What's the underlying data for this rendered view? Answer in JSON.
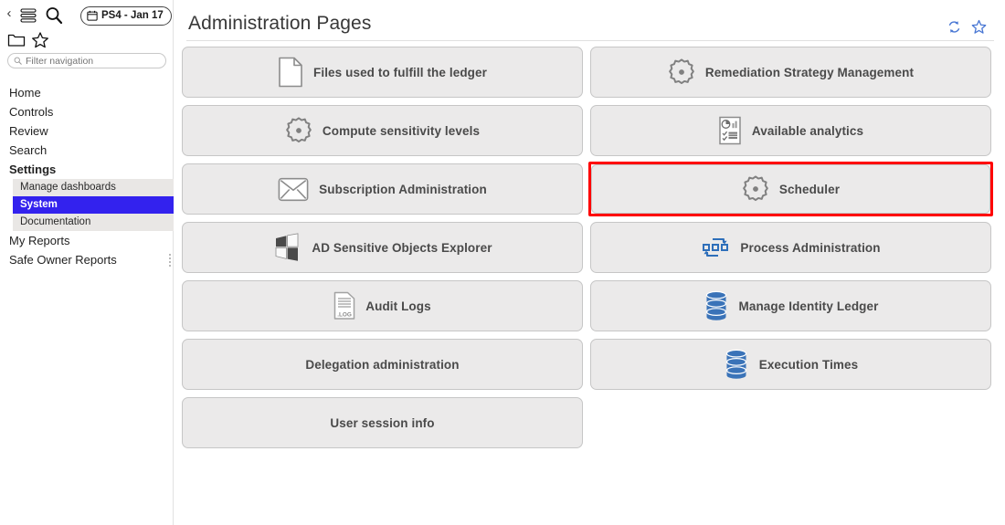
{
  "sidebar": {
    "icons": {
      "back": "back-chevron-icon",
      "menu": "hamburger-menu-icon",
      "search": "search-icon",
      "folder": "folder-icon",
      "star": "star-icon",
      "calendar": "calendar-icon"
    },
    "date_badge": "PS4 - Jan 17",
    "filter": {
      "placeholder": "Filter navigation",
      "value": ""
    },
    "items": [
      {
        "label": "Home",
        "bold": false
      },
      {
        "label": "Controls",
        "bold": false
      },
      {
        "label": "Review",
        "bold": false
      },
      {
        "label": "Search",
        "bold": false
      },
      {
        "label": "Settings",
        "bold": true
      }
    ],
    "subitems": [
      {
        "label": "Manage dashboards",
        "active": false
      },
      {
        "label": "System",
        "active": true
      },
      {
        "label": "Documentation",
        "active": false
      }
    ],
    "items_after": [
      {
        "label": "My Reports",
        "bold": false
      },
      {
        "label": "Safe Owner Reports",
        "bold": false
      }
    ]
  },
  "header": {
    "title": "Administration Pages",
    "refresh_icon": "refresh-icon",
    "favorite_icon": "star-icon",
    "accent_color": "#4a78d4"
  },
  "tiles": [
    {
      "label": "Files used to fulfill the ledger",
      "icon": "document-icon",
      "highlighted": false
    },
    {
      "label": "Remediation Strategy Management",
      "icon": "gear-icon",
      "highlighted": false
    },
    {
      "label": "Compute sensitivity levels",
      "icon": "gear-icon",
      "highlighted": false
    },
    {
      "label": "Available analytics",
      "icon": "analytics-report-icon",
      "highlighted": false
    },
    {
      "label": "Subscription Administration",
      "icon": "envelope-icon",
      "highlighted": false
    },
    {
      "label": "Scheduler",
      "icon": "gear-icon",
      "highlighted": true
    },
    {
      "label": "AD Sensitive Objects Explorer",
      "icon": "windows-checkerboard-icon",
      "highlighted": false
    },
    {
      "label": "Process Administration",
      "icon": "process-flow-icon",
      "highlighted": false
    },
    {
      "label": "Audit Logs",
      "icon": "log-file-icon",
      "highlighted": false
    },
    {
      "label": "Manage Identity Ledger",
      "icon": "database-icon",
      "highlighted": false
    },
    {
      "label": "Delegation administration",
      "icon": "none",
      "highlighted": false
    },
    {
      "label": "Execution Times",
      "icon": "database-icon",
      "highlighted": false
    },
    {
      "label": "User session info",
      "icon": "none",
      "highlighted": false
    }
  ],
  "colors": {
    "tile_bg": "#ebeaea",
    "tile_border": "#c6c6c6",
    "highlight": "#ff0000",
    "active_nav": "#3322ee",
    "icon_blue": "#3a73b8",
    "icon_gray": "#808080"
  }
}
